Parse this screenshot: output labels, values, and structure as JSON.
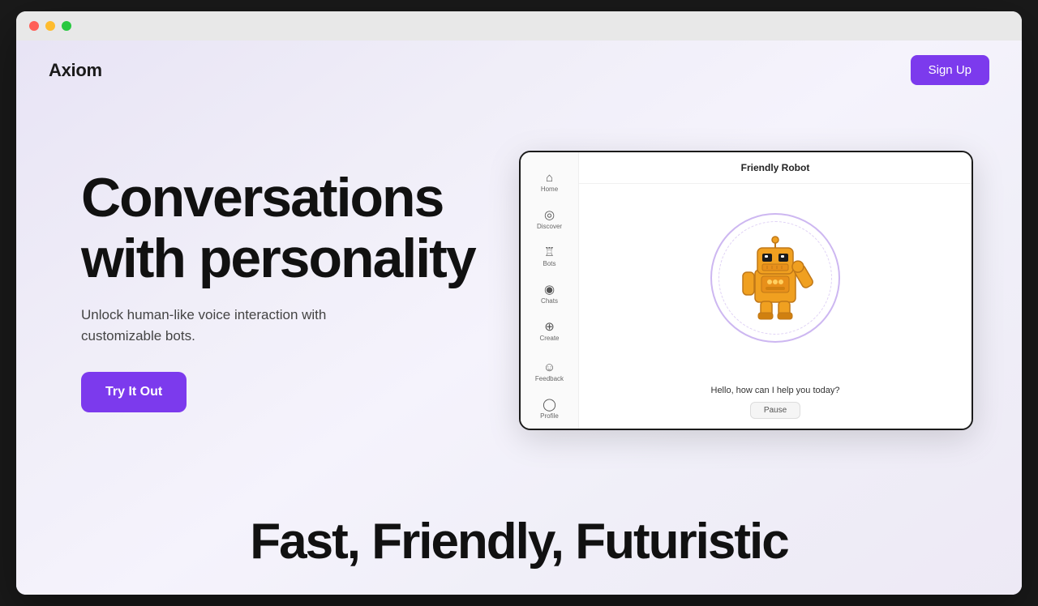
{
  "browser": {
    "traffic_lights": [
      "red",
      "yellow",
      "green"
    ]
  },
  "navbar": {
    "logo": "Axiom",
    "signup_label": "Sign Up"
  },
  "hero": {
    "title_line1": "Conversations",
    "title_line2": "with personality",
    "subtitle": "Unlock human-like voice interaction with customizable bots.",
    "cta_label": "Try It Out"
  },
  "mockup": {
    "header": "Friendly Robot",
    "sidebar_items": [
      {
        "icon": "⌂",
        "label": "Home"
      },
      {
        "icon": "◎",
        "label": "Discover"
      },
      {
        "icon": "♖",
        "label": "Bots"
      },
      {
        "icon": "◉",
        "label": "Chats"
      },
      {
        "icon": "⊕",
        "label": "Create"
      }
    ],
    "sidebar_bottom_items": [
      {
        "icon": "☺",
        "label": "Feedback"
      },
      {
        "icon": "◯",
        "label": "Profile"
      }
    ],
    "chat_text": "Hello, how can I help you today?",
    "pause_label": "Pause"
  },
  "bottom": {
    "tagline": "Fast, Friendly, Futuristic"
  }
}
